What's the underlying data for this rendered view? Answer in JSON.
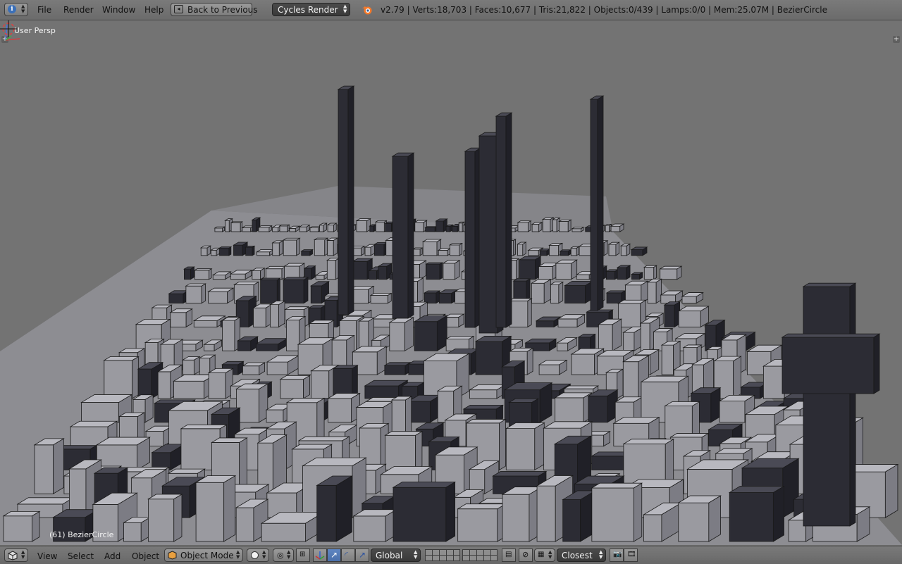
{
  "header": {
    "menus": [
      "File",
      "Render",
      "Window",
      "Help"
    ],
    "back_button": "Back to Previous",
    "render_engine": "Cycles Render",
    "stats": "v2.79 | Verts:18,703 | Faces:10,677 | Tris:21,822 | Objects:0/439 | Lamps:0/0 | Mem:25.07M | BezierCircle"
  },
  "viewport": {
    "view_label": "User Persp",
    "object_label": "(61) BezierCircle"
  },
  "footer": {
    "menus": [
      "View",
      "Select",
      "Add",
      "Object"
    ],
    "mode": "Object Mode",
    "orientation": "Global",
    "snap_target": "Closest"
  },
  "icons": {
    "info_editor": "info-icon",
    "blender_logo": "blender-logo-icon",
    "viewport_editor": "3d-view-icon",
    "mode": "object-mode-cube-icon",
    "shading": "solid-shading-icon",
    "pivot": "pivot-point-icon",
    "manipulator": "manipulator-icon",
    "layers": "layers-icon",
    "lock": "lock-layers-icon",
    "proportional": "proportional-edit-icon",
    "snap": "snap-magnet-icon",
    "render_still": "render-image-icon",
    "render_anim": "render-animation-icon"
  },
  "colors": {
    "header_bg": "#707070",
    "viewport_bg": "#737373",
    "accent_blue": "#5f86c2",
    "select_dark": "#3e3e3e"
  }
}
